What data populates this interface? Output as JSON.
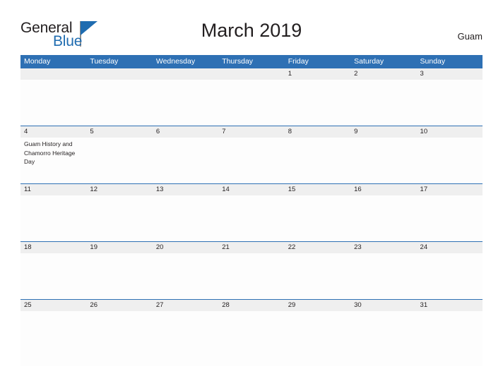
{
  "brand": {
    "name_part1": "General",
    "name_part2": "Blue",
    "triangle_icon": "triangle-icon"
  },
  "header": {
    "title": "March 2019",
    "country": "Guam"
  },
  "colors": {
    "header_blue": "#2e70b4",
    "date_strip_gray": "#efefef",
    "brand_blue": "#1f6cb0",
    "text": "#231f20"
  },
  "calendar": {
    "weekdays": [
      "Monday",
      "Tuesday",
      "Wednesday",
      "Thursday",
      "Friday",
      "Saturday",
      "Sunday"
    ],
    "weeks": [
      {
        "days": [
          {
            "date": "",
            "event": ""
          },
          {
            "date": "",
            "event": ""
          },
          {
            "date": "",
            "event": ""
          },
          {
            "date": "",
            "event": ""
          },
          {
            "date": "1",
            "event": ""
          },
          {
            "date": "2",
            "event": ""
          },
          {
            "date": "3",
            "event": ""
          }
        ]
      },
      {
        "days": [
          {
            "date": "4",
            "event": "Guam History and Chamorro Heritage Day"
          },
          {
            "date": "5",
            "event": ""
          },
          {
            "date": "6",
            "event": ""
          },
          {
            "date": "7",
            "event": ""
          },
          {
            "date": "8",
            "event": ""
          },
          {
            "date": "9",
            "event": ""
          },
          {
            "date": "10",
            "event": ""
          }
        ]
      },
      {
        "days": [
          {
            "date": "11",
            "event": ""
          },
          {
            "date": "12",
            "event": ""
          },
          {
            "date": "13",
            "event": ""
          },
          {
            "date": "14",
            "event": ""
          },
          {
            "date": "15",
            "event": ""
          },
          {
            "date": "16",
            "event": ""
          },
          {
            "date": "17",
            "event": ""
          }
        ]
      },
      {
        "days": [
          {
            "date": "18",
            "event": ""
          },
          {
            "date": "19",
            "event": ""
          },
          {
            "date": "20",
            "event": ""
          },
          {
            "date": "21",
            "event": ""
          },
          {
            "date": "22",
            "event": ""
          },
          {
            "date": "23",
            "event": ""
          },
          {
            "date": "24",
            "event": ""
          }
        ]
      },
      {
        "days": [
          {
            "date": "25",
            "event": ""
          },
          {
            "date": "26",
            "event": ""
          },
          {
            "date": "27",
            "event": ""
          },
          {
            "date": "28",
            "event": ""
          },
          {
            "date": "29",
            "event": ""
          },
          {
            "date": "30",
            "event": ""
          },
          {
            "date": "31",
            "event": ""
          }
        ]
      }
    ]
  }
}
